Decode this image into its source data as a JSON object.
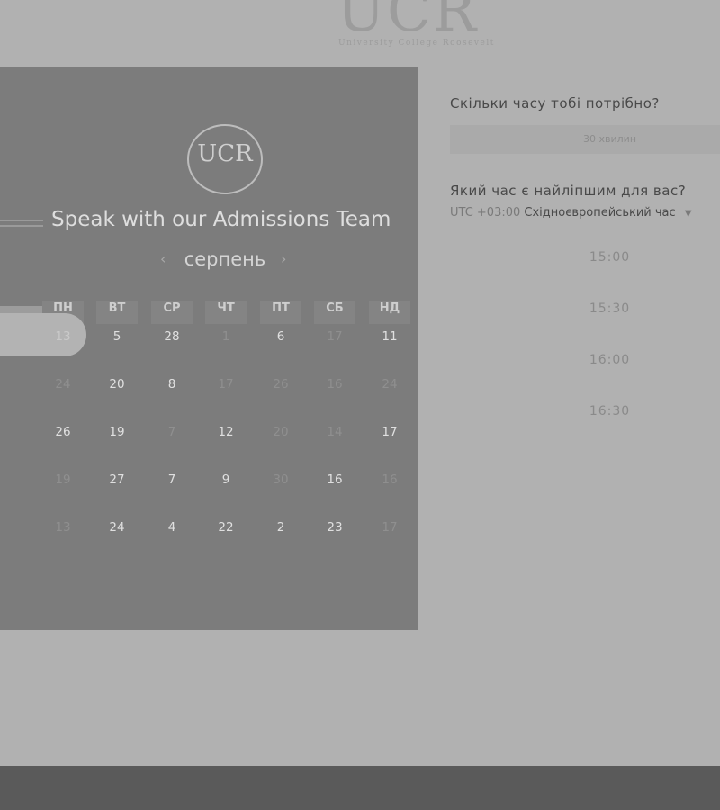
{
  "header": {
    "logo_mark": "UCR",
    "logo_subtitle": "University College Roosevelt"
  },
  "panel": {
    "badge_mark": "UCR",
    "title": "Speak with our Admissions Team",
    "month": "серпень",
    "prev_icon": "chevron-left-icon",
    "next_icon": "chevron-right-icon",
    "weekdays": [
      "ПН",
      "ВТ",
      "СР",
      "ЧТ",
      "ПТ",
      "СБ",
      "НД"
    ],
    "weeks": [
      [
        "13",
        "5",
        "28",
        "1",
        "6",
        "17",
        "11"
      ],
      [
        "24",
        "20",
        "8",
        "17",
        "26",
        "16",
        "24"
      ],
      [
        "26",
        "19",
        "7",
        "12",
        "20",
        "14",
        "17"
      ],
      [
        "19",
        "27",
        "7",
        "9",
        "30",
        "16",
        "16"
      ],
      [
        "13",
        "24",
        "4",
        "22",
        "2",
        "23",
        "17"
      ]
    ],
    "available": [
      [
        false,
        true,
        true,
        false,
        true,
        false,
        true
      ],
      [
        false,
        true,
        true,
        false,
        false,
        false,
        false
      ],
      [
        true,
        true,
        false,
        true,
        false,
        false,
        true
      ],
      [
        false,
        true,
        true,
        true,
        false,
        true,
        false
      ],
      [
        false,
        true,
        true,
        true,
        true,
        true,
        false
      ]
    ],
    "selected_day": "13"
  },
  "booking": {
    "duration_question": "Скільки часу тобі потрібно?",
    "duration_value": "30 хвилин",
    "time_question": "Який час є найліпшим для вас?",
    "timezone_offset": "UTC +03:00",
    "timezone_name": "Східноєвропейський час",
    "timezone_caret": "chevron-down-icon",
    "slots": [
      "15:00",
      "15:30",
      "16:00",
      "16:30"
    ]
  },
  "colors": {
    "background": "#b1b1b1",
    "panel": "#7c7c7c",
    "footer": "#5a5a5a"
  }
}
